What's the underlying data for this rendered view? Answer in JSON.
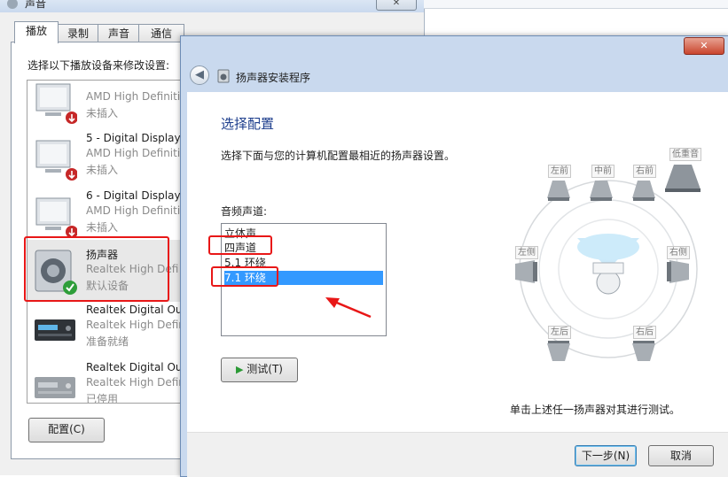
{
  "sound_window": {
    "title": "声音",
    "tabs": [
      "播放",
      "录制",
      "声音",
      "通信"
    ],
    "instruction": "选择以下播放设备来修改设置:",
    "devices": [
      {
        "name": "",
        "desc": "AMD High Definiti",
        "status": "未插入"
      },
      {
        "name": "5 - Digital Display",
        "desc": "AMD High Definiti",
        "status": "未插入"
      },
      {
        "name": "6 - Digital Display",
        "desc": "AMD High Definiti",
        "status": "未插入"
      },
      {
        "name": "扬声器",
        "desc": "Realtek High Defi",
        "status": "默认设备"
      },
      {
        "name": "Realtek Digital Ou",
        "desc": "Realtek High Defir",
        "status": "准备就绪"
      },
      {
        "name": "Realtek Digital Ou",
        "desc": "Realtek High Defir",
        "status": "已停用"
      }
    ],
    "configure_button": "配置(C)"
  },
  "wizard": {
    "title": "扬声器安装程序",
    "heading": "选择配置",
    "description": "选择下面与您的计算机配置最相近的扬声器设置。",
    "channels_label": "音频声道:",
    "channels": [
      "立体声",
      "四声道",
      "5.1 环绕",
      "7.1 环绕"
    ],
    "selected_channel": "7.1 环绕",
    "test_button": "测试(T)",
    "speaker_labels": {
      "front_left": "左前",
      "center": "中前",
      "front_right": "右前",
      "subwoofer": "低重音",
      "side_left": "左侧",
      "side_right": "右侧",
      "rear_left": "左后",
      "rear_right": "右后"
    },
    "hint": "单击上述任一扬声器对其进行测试。",
    "next_button": "下一步(N)",
    "cancel_button": "取消",
    "close_glyph": "✕"
  },
  "colors": {
    "selection": "#3399ff",
    "annotation_red": "#e81717"
  }
}
